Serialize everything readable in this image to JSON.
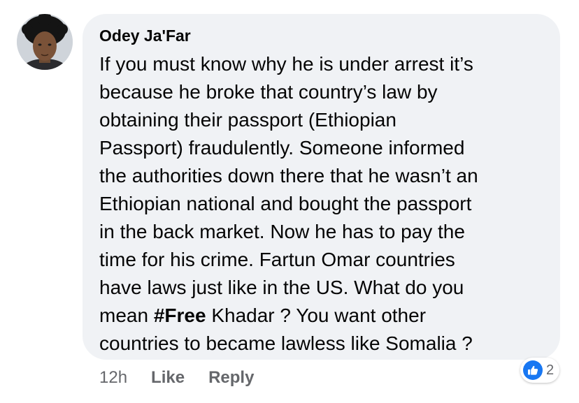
{
  "comment": {
    "author": "Odey Ja'Far",
    "text_lines": [
      "If you must know why he is under arrest it’s",
      "because he broke that country’s law by",
      "obtaining their passport (Ethiopian",
      "Passport) fraudulently. Someone informed",
      "the authorities down there that he wasn’t an",
      "Ethiopian national and bought the passport",
      "in the back market. Now he has to pay the",
      "time for his crime. Fartun Omar countries",
      "have laws just like in the US. What do you"
    ],
    "line10_before": "mean ",
    "hashtag": "#Free",
    "line10_after": " Khadar ? You want other",
    "text_last_line": "countries to became lawless like Somalia ?"
  },
  "actions": {
    "timestamp": "12h",
    "like_label": "Like",
    "reply_label": "Reply"
  },
  "reactions": {
    "icon": "like-thumb-icon",
    "count": "2"
  },
  "colors": {
    "bubble_bg": "#f0f2f5",
    "text": "#050505",
    "meta": "#65676b",
    "like_blue": "#1877f2"
  }
}
